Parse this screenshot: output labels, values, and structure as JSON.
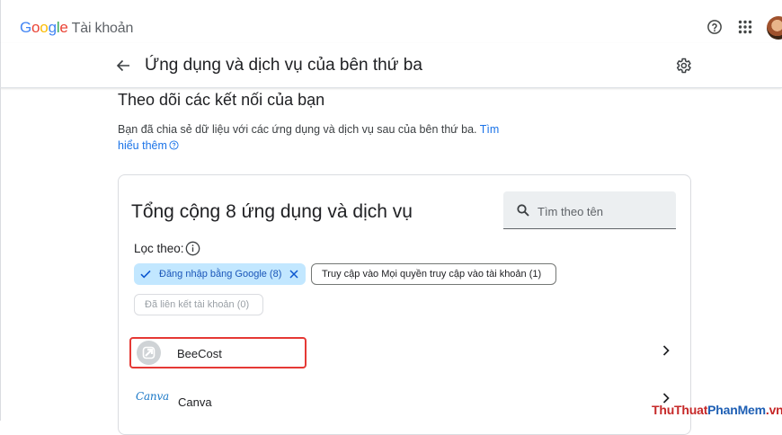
{
  "header": {
    "logo_letters": [
      "G",
      "o",
      "o",
      "g",
      "l",
      "e"
    ],
    "product_name": "Tài khoản",
    "icons": [
      "help-circle-icon",
      "apps-grid-icon",
      "avatar"
    ]
  },
  "subheader": {
    "title": "Ứng dụng và dịch vụ của bên thứ ba"
  },
  "section": {
    "title": "Theo dõi các kết nối của bạn",
    "description": "Bạn đã chia sẻ dữ liệu với các ứng dụng và dịch vụ sau của bên thứ ba.",
    "learn_more_link": "Tìm hiểu thêm"
  },
  "card": {
    "total_label": "Tổng cộng 8 ứng dụng và dịch vụ",
    "search_placeholder": "Tìm theo tên",
    "filter_label": "Lọc theo:",
    "chips": [
      {
        "label": "Đăng nhập bằng Google (8)",
        "state": "selected"
      },
      {
        "label": "Truy cập vào Mọi quyền truy cập vào tài khoản (1)",
        "state": "outlined"
      },
      {
        "label": "Đã liên kết tài khoản (0)",
        "state": "disabled"
      }
    ],
    "apps": [
      {
        "name": "BeeCost",
        "logo": "link-icon",
        "highlighted": true
      },
      {
        "name": "Canva",
        "logo_text": "Canva"
      }
    ]
  },
  "watermark": {
    "part1": "ThuThuat",
    "part2": "PhanMem",
    "part3": ".vn"
  },
  "colors": {
    "accent_blue": "#1a73e8",
    "chip_selected_bg": "#c2e7ff",
    "highlight_red": "#e53935"
  }
}
